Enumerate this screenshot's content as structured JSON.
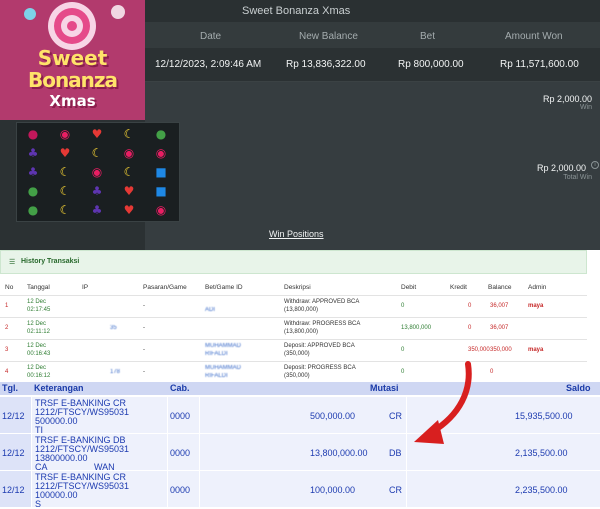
{
  "game": {
    "title": "Sweet Bonanza Xmas",
    "columns": {
      "date": "Date",
      "new_balance": "New Balance",
      "bet": "Bet",
      "amount_won": "Amount Won"
    },
    "row": {
      "date": "12/12/2023, 2:09:46 AM",
      "new_balance": "Rp 13,836,322.00",
      "bet": "Rp 800,000.00",
      "amount_won": "Rp 11,571,600.00"
    },
    "win_value": "Rp 2,000.00",
    "win_label": "Win",
    "total_win_value": "Rp 2,000.00",
    "total_win_label": "Total Win",
    "win_positions_link": "Win Positions",
    "logo": {
      "line1": "Sweet",
      "line2": "Bonanza",
      "line3": "Xmas"
    }
  },
  "history": {
    "title": "History Transaksi",
    "columns": [
      "No",
      "Tanggal",
      "IP",
      "Pasaran/Game",
      "Bet/Game ID",
      "Deskripsi",
      "Debit",
      "Kredit",
      "Balance",
      "Admin"
    ],
    "rows": [
      {
        "no": "1",
        "date": "12 Dec",
        "time": "02:17:45",
        "ip": "",
        "game": "-",
        "bet_id": "",
        "bet_id2": "ADI",
        "desc": "Withdraw: APPROVED BCA",
        "desc2": "(13,800,000)",
        "debit": "0",
        "kredit": "0",
        "balance": "36,007",
        "admin": "maya"
      },
      {
        "no": "2",
        "date": "12 Dec",
        "time": "02:11:12",
        "ip": "35",
        "game": "-",
        "bet_id": "",
        "bet_id2": "",
        "desc": "Withdraw: PROGRESS BCA",
        "desc2": "(13,800,000)",
        "debit": "13,800,000",
        "kredit": "0",
        "balance": "36,007",
        "admin": ""
      },
      {
        "no": "3",
        "date": "12 Dec",
        "time": "00:16:43",
        "ip": "",
        "game": "-",
        "bet_id": "MUHAMMAD",
        "bet_id2": "RIFALDI",
        "desc": "Deposit: APPROVED BCA",
        "desc2": "(350,000)",
        "debit": "0",
        "kredit": "350,000",
        "balance": "350,000",
        "admin": "maya"
      },
      {
        "no": "4",
        "date": "12 Dec",
        "time": "00:16:12",
        "ip": "178",
        "game": "-",
        "bet_id": "MUHAMMAD",
        "bet_id2": "RIFALDI",
        "desc": "Deposit: PROGRESS BCA",
        "desc2": "(350,000)",
        "debit": "0",
        "kredit": "",
        "balance": "0",
        "admin": ""
      }
    ]
  },
  "bank": {
    "columns": {
      "tgl": "Tgl.",
      "keterangan": "Keterangan",
      "cab": "Cab.",
      "mutasi": "Mutasi",
      "saldo": "Saldo"
    },
    "rows": [
      {
        "tgl": "12/12",
        "ket1": "TRSF E-BANKING CR",
        "ket2": "1212/FTSCY/WS95031",
        "ket3": "500000.00",
        "ket4": "TI",
        "cab": "0000",
        "mutasi": "500,000.00",
        "type": "CR",
        "saldo": "15,935,500.00"
      },
      {
        "tgl": "12/12",
        "ket1": "TRSF E-BANKING DB",
        "ket2": "1212/FTSCY/WS95031",
        "ket3": "13800000.00",
        "ket4": "CA",
        "ket5": "WAN",
        "cab": "0000",
        "mutasi": "13,800,000.00",
        "type": "DB",
        "saldo": "2,135,500.00"
      },
      {
        "tgl": "12/12",
        "ket1": "TRSF E-BANKING CR",
        "ket2": "1212/FTSCY/WS95031",
        "ket3": "100000.00",
        "ket4": "S",
        "cab": "0000",
        "mutasi": "100,000.00",
        "type": "CR",
        "saldo": "2,235,500.00"
      }
    ]
  },
  "colors": {
    "arrow": "#d81f1f",
    "bank_text": "#1d3bb0",
    "panel_bg": "#2b3133"
  }
}
